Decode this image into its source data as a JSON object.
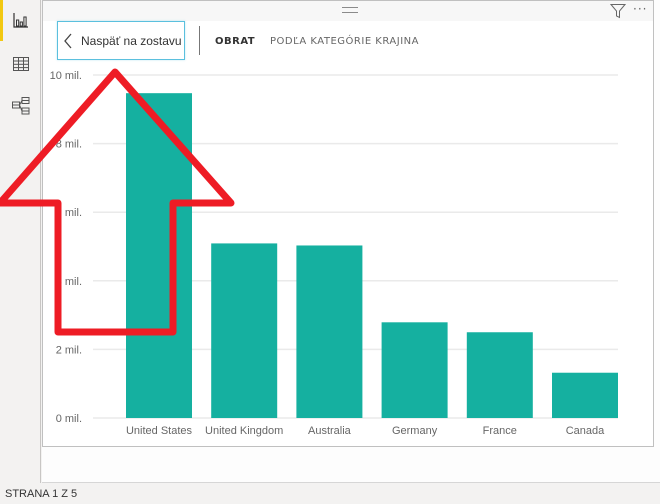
{
  "nav": {
    "items": [
      {
        "name": "report-view",
        "icon": "bar-chart-icon",
        "active": true
      },
      {
        "name": "data-view",
        "icon": "table-grid-icon",
        "active": false
      },
      {
        "name": "model-view",
        "icon": "model-diagram-icon",
        "active": false
      }
    ],
    "active_color": "#f2c811"
  },
  "visual": {
    "back_button_label": "Naspäť na zostavu",
    "title_main": "OBRAT",
    "title_sub": "PODĽA KATEGÓRIE KRAJINA",
    "header_icons": [
      "drag-handle-icon",
      "filter-icon",
      "more-options-icon"
    ],
    "more_label": "···"
  },
  "chart_data": {
    "type": "bar",
    "title": "OBRAT PODĽA KATEGÓRIE KRAJINA",
    "xlabel": "",
    "ylabel": "",
    "categories": [
      "United States",
      "United Kingdom",
      "Australia",
      "Germany",
      "France",
      "Canada"
    ],
    "values": [
      9.47,
      5.09,
      5.03,
      2.79,
      2.5,
      1.32
    ],
    "unit": "mil.",
    "ylim": [
      0,
      10
    ],
    "yticks": [
      0,
      2,
      4,
      6,
      8,
      10
    ],
    "ytick_labels": [
      "0 mil.",
      "2 mil.",
      "4 mil.",
      "6 mil.",
      "8 mil.",
      "10 mil."
    ],
    "grid": true,
    "bar_color": "#15b0a0",
    "legend": "none"
  },
  "annotation": {
    "shape": "up-arrow-outline",
    "color": "#ee1c25",
    "points_to": "back-button"
  },
  "status_bar": {
    "page_label": "STRANA 1 Z 5"
  }
}
